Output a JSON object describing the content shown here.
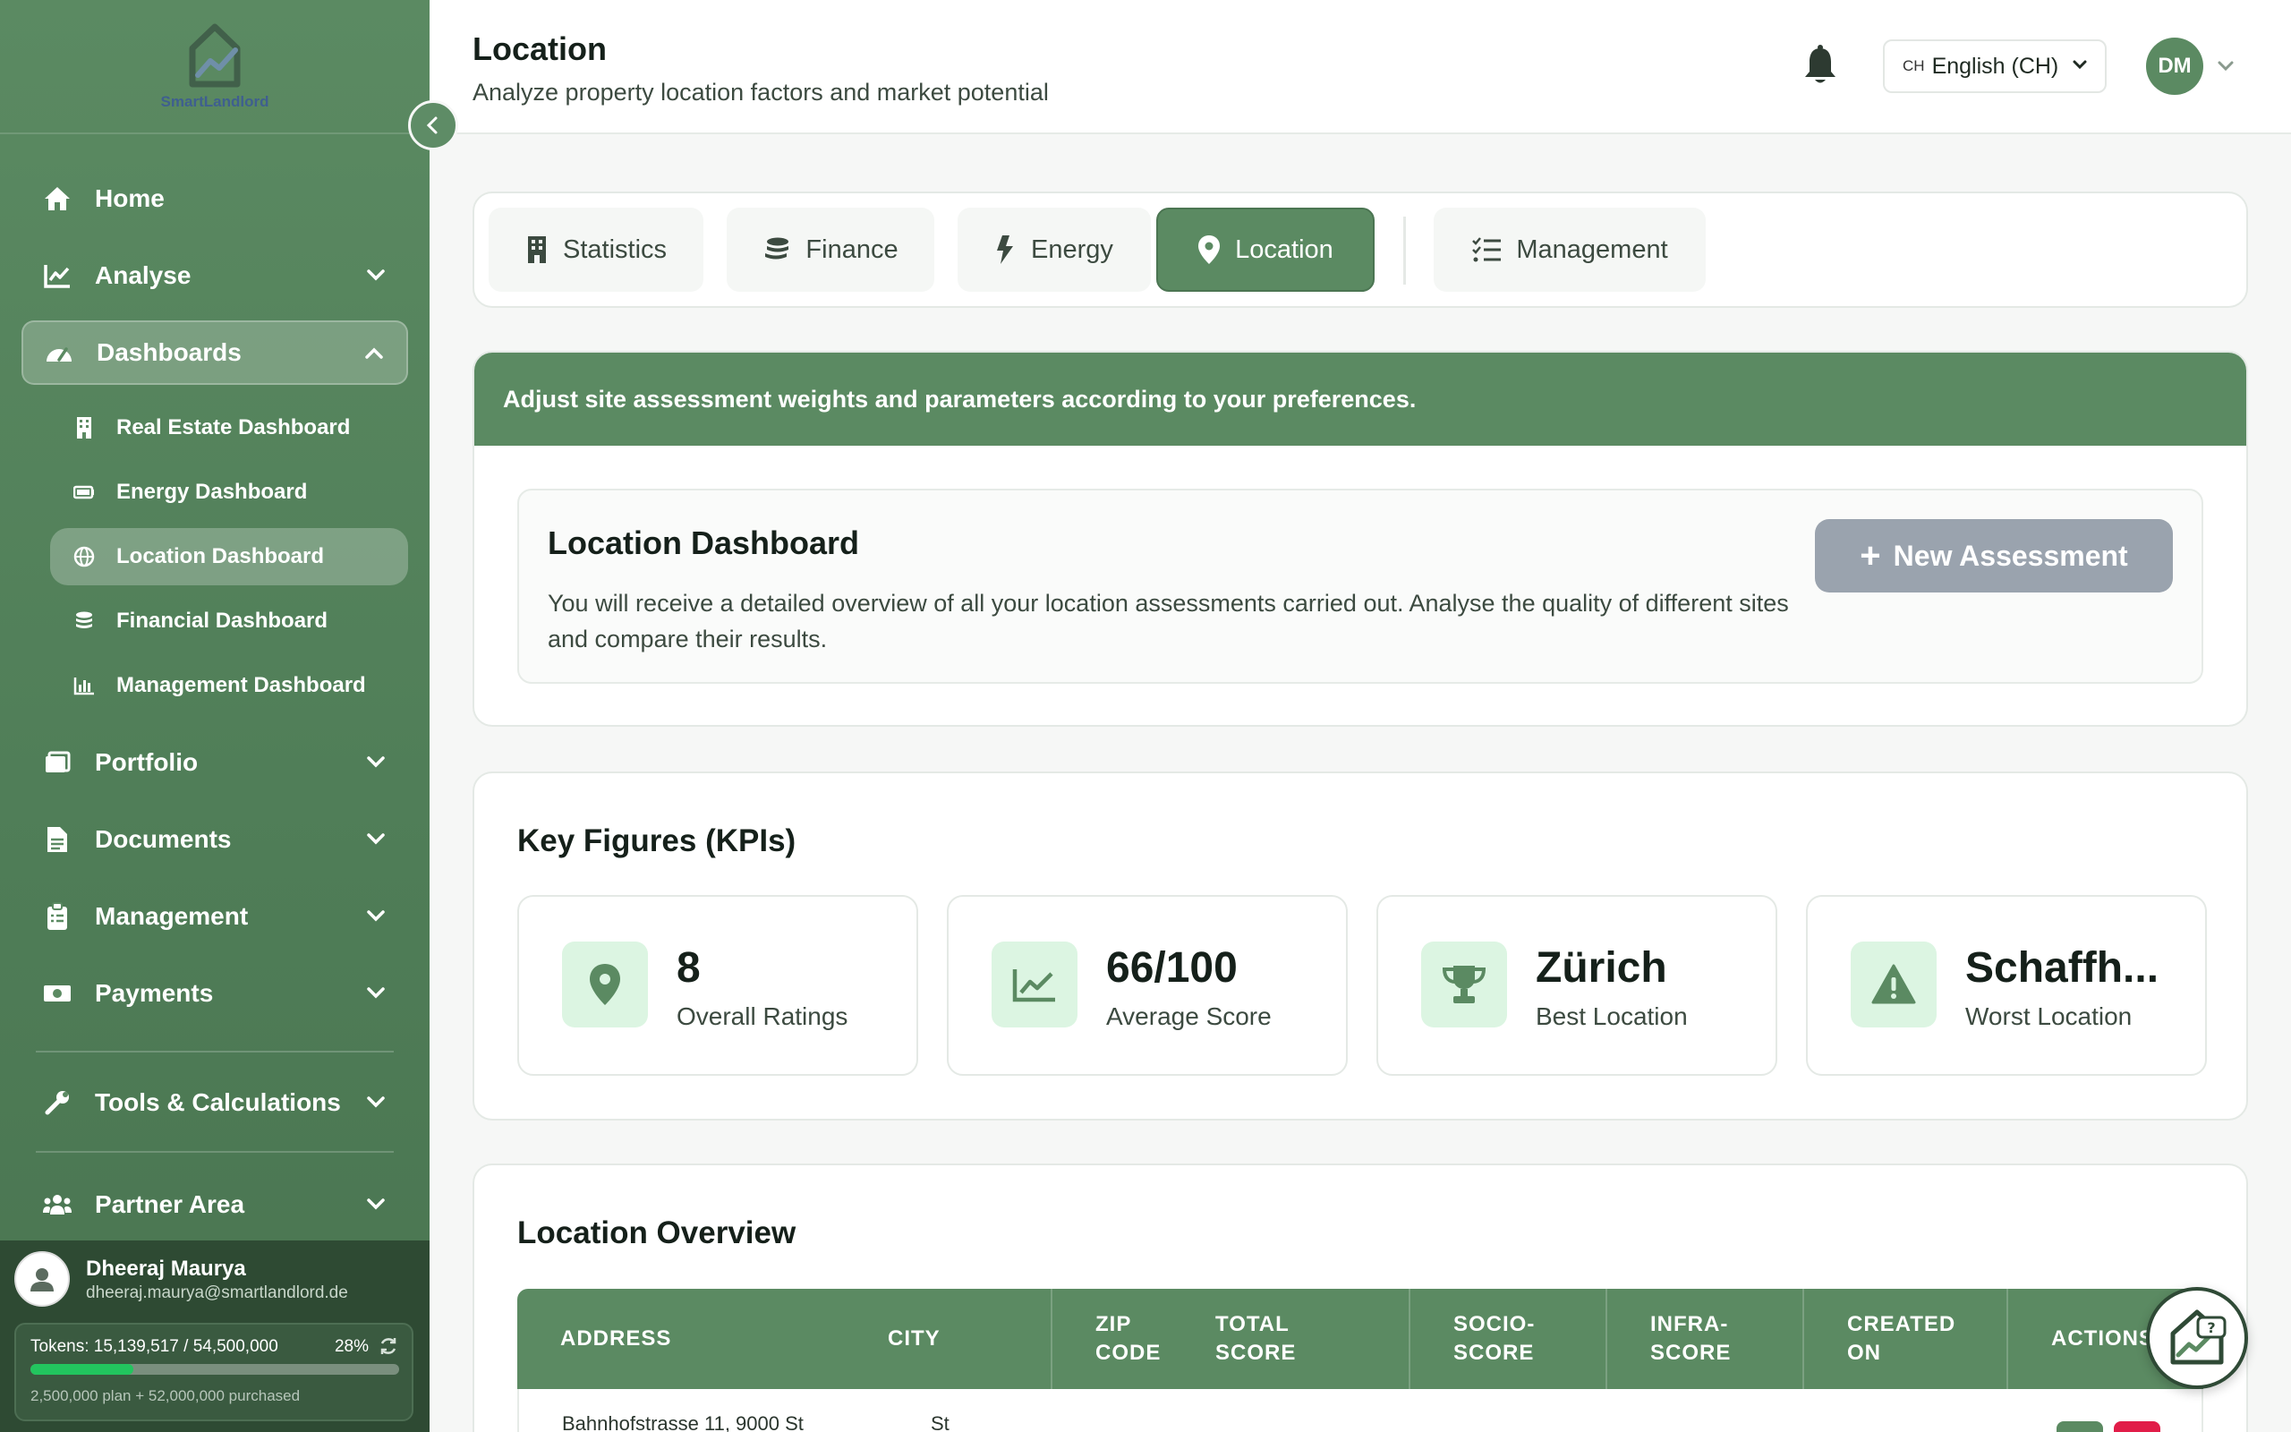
{
  "sidebar": {
    "logo_text": "SmartLandlord",
    "items": [
      {
        "label": "Home"
      },
      {
        "label": "Analyse"
      },
      {
        "label": "Dashboards"
      },
      {
        "label": "Portfolio"
      },
      {
        "label": "Documents"
      },
      {
        "label": "Management"
      },
      {
        "label": "Payments"
      },
      {
        "label": "Tools & Calculations"
      },
      {
        "label": "Partner Area"
      }
    ],
    "sub_items": [
      {
        "label": "Real Estate Dashboard"
      },
      {
        "label": "Energy Dashboard"
      },
      {
        "label": "Location Dashboard"
      },
      {
        "label": "Financial Dashboard"
      },
      {
        "label": "Management Dashboard"
      }
    ],
    "user": {
      "name": "Dheeraj Maurya",
      "email": "dheeraj.maurya@smartlandlord.de",
      "tokens_text": "Tokens: 15,139,517 / 54,500,000",
      "tokens_percent_text": "28%",
      "tokens_fraction": 0.28,
      "tokens_sub": "2,500,000 plan + 52,000,000 purchased"
    }
  },
  "header": {
    "title": "Location",
    "subtitle": "Analyze property location factors and market potential",
    "lang_flag": "CH",
    "lang_label": "English (CH)",
    "avatar_initials": "DM"
  },
  "tabs": [
    {
      "label": "Statistics"
    },
    {
      "label": "Finance"
    },
    {
      "label": "Energy"
    },
    {
      "label": "Location"
    },
    {
      "label": "Management"
    }
  ],
  "banner": {
    "text": "Adjust site assessment weights and parameters according to your preferences.",
    "title": "Location Dashboard",
    "description": "You will receive a detailed overview of all your location assessments carried out. Analyse the quality of different sites and compare their results.",
    "button_label": "New Assessment"
  },
  "kpis": {
    "title": "Key Figures (KPIs)",
    "items": [
      {
        "value": "8",
        "label": "Overall Ratings"
      },
      {
        "value": "66/100",
        "label": "Average Score"
      },
      {
        "value": "Zürich",
        "label": "Best Location"
      },
      {
        "value": "Schaffh...",
        "label": "Worst Location"
      }
    ]
  },
  "overview": {
    "title": "Location Overview",
    "columns": [
      "ADDRESS",
      "CITY",
      "ZIP CODE",
      "TOTAL SCORE",
      "SOCIO-SCORE",
      "INFRA-SCORE",
      "CREATED ON",
      "ACTIONS"
    ],
    "columns_display": [
      [
        "ADDRESS"
      ],
      [
        "CITY"
      ],
      [
        "ZIP",
        "CODE"
      ],
      [
        "TOTAL",
        "SCORE"
      ],
      [
        "SOCIO-",
        "SCORE"
      ],
      [
        "INFRA-",
        "SCORE"
      ],
      [
        "CREATED",
        "ON"
      ],
      [
        "ACTIONS"
      ]
    ],
    "rows": [
      {
        "address": "Bahnhofstrasse 11, 9000 St",
        "city": "St"
      }
    ]
  },
  "colors": {
    "primary": "#5b8a62",
    "kpi_icon_bg": "#dcf5e2",
    "disabled_button": "#9aa3ae",
    "delete_action": "#e11d48"
  }
}
